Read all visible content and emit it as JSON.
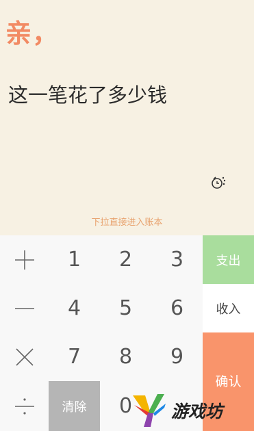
{
  "header": {
    "greeting": "亲，",
    "question": "这一笔花了多少钱",
    "hint": "下拉直接进入账本"
  },
  "icons": {
    "voice": "bell-mic-icon"
  },
  "keypad": {
    "rows": [
      [
        "plus-icon",
        "1",
        "2",
        "3"
      ],
      [
        "minus-icon",
        "4",
        "5",
        "6"
      ],
      [
        "multiply-icon",
        "7",
        "8",
        "9"
      ],
      [
        "divide-icon",
        "clear",
        "0",
        "dot"
      ]
    ],
    "clear_label": "清除",
    "zero_label": "0"
  },
  "actions": {
    "expense_label": "支出",
    "income_label": "收入",
    "confirm_label": "确认"
  },
  "colors": {
    "background": "#f7f1e3",
    "accent_orange": "#f28a63",
    "expense_green": "#a9dd9d",
    "confirm_orange": "#f9946b",
    "clear_gray": "#b5b5b5"
  },
  "watermark": {
    "text": "游戏坊"
  }
}
